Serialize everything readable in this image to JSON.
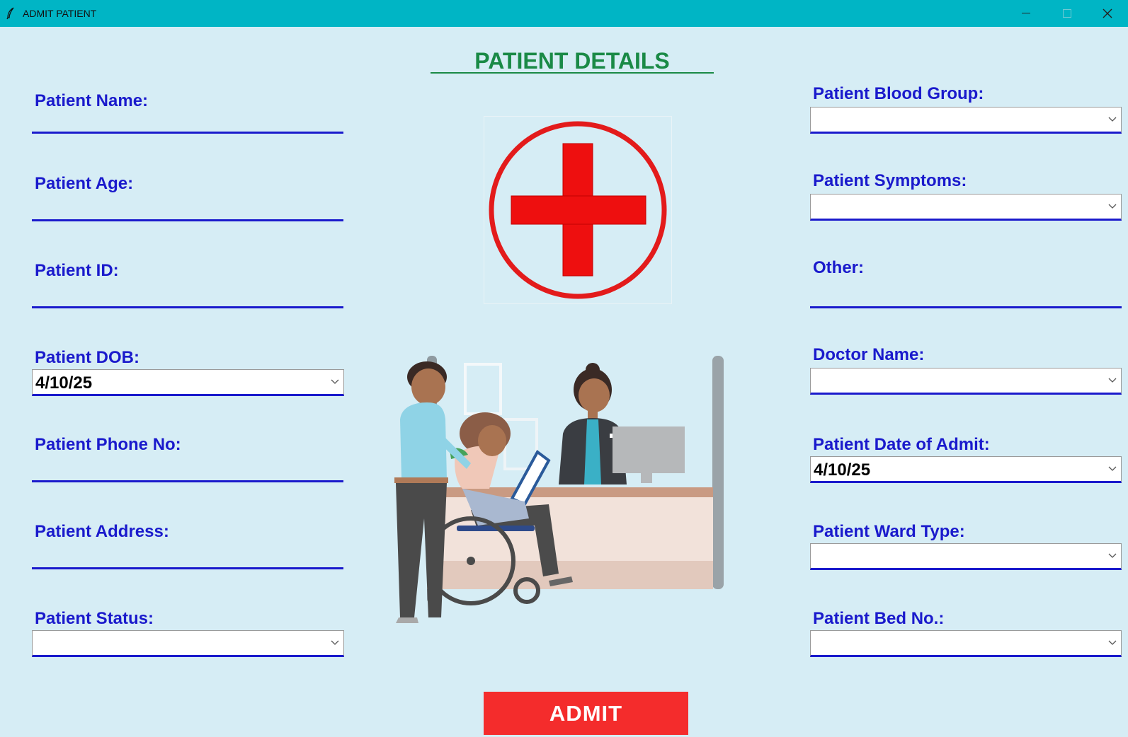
{
  "window": {
    "title": "ADMIT PATIENT"
  },
  "form": {
    "heading": "PATIENT DETAILS",
    "left": {
      "name_label": "Patient Name:",
      "age_label": "Patient Age:",
      "id_label": "Patient ID:",
      "dob_label": "Patient DOB:",
      "dob_value": "4/10/25",
      "phone_label": "Patient Phone No:",
      "address_label": "Patient Address:",
      "status_label": "Patient Status:",
      "status_value": ""
    },
    "right": {
      "blood_group_label": "Patient Blood Group:",
      "blood_group_value": "",
      "symptoms_label": "Patient Symptoms:",
      "symptoms_value": "",
      "other_label": "Other:",
      "doctor_label": "Doctor Name:",
      "doctor_value": "",
      "admit_date_label": "Patient Date of Admit:",
      "admit_date_value": "4/10/25",
      "ward_label": "Patient Ward Type:",
      "ward_value": "",
      "bed_label": "Patient Bed No.:",
      "bed_value": ""
    },
    "submit_label": "ADMIT"
  },
  "icons": {
    "logo": "red-cross-icon",
    "illustration": "hospital-reception-illustration"
  },
  "colors": {
    "titlebar": "#00b5c5",
    "background": "#d6edf5",
    "label": "#1a1acc",
    "heading": "#1a8a46",
    "button": "#f42c2c"
  }
}
